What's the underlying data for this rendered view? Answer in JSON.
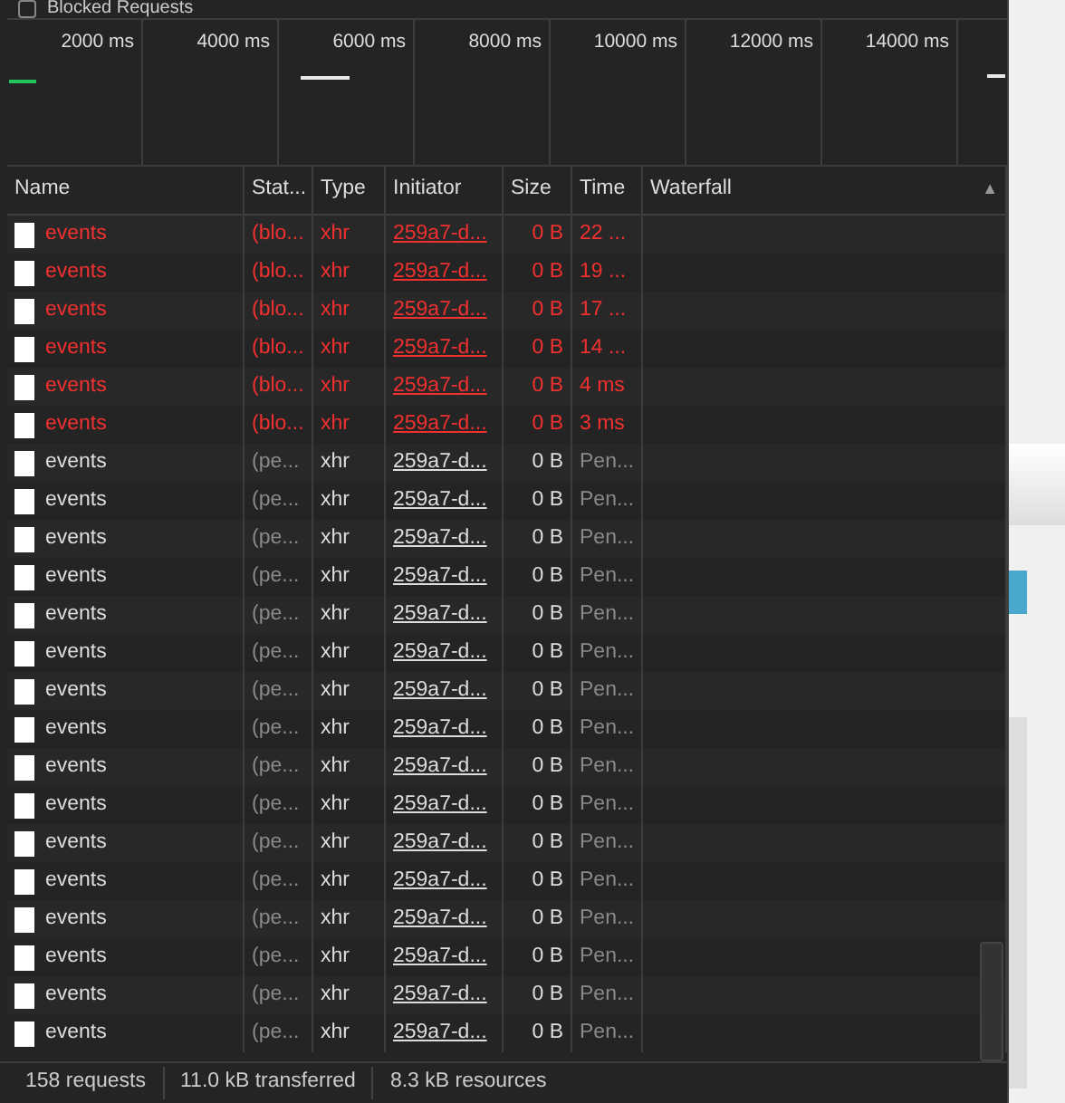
{
  "filter_bar": {
    "blocked_requests": {
      "label": "Blocked Requests",
      "checked": false
    }
  },
  "overview": {
    "ticks": [
      "2000 ms",
      "4000 ms",
      "6000 ms",
      "8000 ms",
      "10000 ms",
      "12000 ms",
      "14000 ms"
    ]
  },
  "table": {
    "columns": [
      {
        "label": "Name"
      },
      {
        "label": "Stat..."
      },
      {
        "label": "Type"
      },
      {
        "label": "Initiator"
      },
      {
        "label": "Size"
      },
      {
        "label": "Time"
      },
      {
        "label": "Waterfall",
        "sort_icon": "▲"
      }
    ],
    "rows": [
      {
        "kind": "blocked",
        "name": "events",
        "status": "(blo...",
        "type": "xhr",
        "initiator": "259a7-d...",
        "size": "0 B",
        "time": "22 ..."
      },
      {
        "kind": "blocked",
        "name": "events",
        "status": "(blo...",
        "type": "xhr",
        "initiator": "259a7-d...",
        "size": "0 B",
        "time": "19 ..."
      },
      {
        "kind": "blocked",
        "name": "events",
        "status": "(blo...",
        "type": "xhr",
        "initiator": "259a7-d...",
        "size": "0 B",
        "time": "17 ..."
      },
      {
        "kind": "blocked",
        "name": "events",
        "status": "(blo...",
        "type": "xhr",
        "initiator": "259a7-d...",
        "size": "0 B",
        "time": "14 ..."
      },
      {
        "kind": "blocked",
        "name": "events",
        "status": "(blo...",
        "type": "xhr",
        "initiator": "259a7-d...",
        "size": "0 B",
        "time": "4 ms"
      },
      {
        "kind": "blocked",
        "name": "events",
        "status": "(blo...",
        "type": "xhr",
        "initiator": "259a7-d...",
        "size": "0 B",
        "time": "3 ms"
      },
      {
        "kind": "pending",
        "name": "events",
        "status": "(pe...",
        "type": "xhr",
        "initiator": "259a7-d...",
        "size": "0 B",
        "time": "Pen..."
      },
      {
        "kind": "pending",
        "name": "events",
        "status": "(pe...",
        "type": "xhr",
        "initiator": "259a7-d...",
        "size": "0 B",
        "time": "Pen..."
      },
      {
        "kind": "pending",
        "name": "events",
        "status": "(pe...",
        "type": "xhr",
        "initiator": "259a7-d...",
        "size": "0 B",
        "time": "Pen..."
      },
      {
        "kind": "pending",
        "name": "events",
        "status": "(pe...",
        "type": "xhr",
        "initiator": "259a7-d...",
        "size": "0 B",
        "time": "Pen..."
      },
      {
        "kind": "pending",
        "name": "events",
        "status": "(pe...",
        "type": "xhr",
        "initiator": "259a7-d...",
        "size": "0 B",
        "time": "Pen..."
      },
      {
        "kind": "pending",
        "name": "events",
        "status": "(pe...",
        "type": "xhr",
        "initiator": "259a7-d...",
        "size": "0 B",
        "time": "Pen..."
      },
      {
        "kind": "pending",
        "name": "events",
        "status": "(pe...",
        "type": "xhr",
        "initiator": "259a7-d...",
        "size": "0 B",
        "time": "Pen..."
      },
      {
        "kind": "pending",
        "name": "events",
        "status": "(pe...",
        "type": "xhr",
        "initiator": "259a7-d...",
        "size": "0 B",
        "time": "Pen..."
      },
      {
        "kind": "pending",
        "name": "events",
        "status": "(pe...",
        "type": "xhr",
        "initiator": "259a7-d...",
        "size": "0 B",
        "time": "Pen..."
      },
      {
        "kind": "pending",
        "name": "events",
        "status": "(pe...",
        "type": "xhr",
        "initiator": "259a7-d...",
        "size": "0 B",
        "time": "Pen..."
      },
      {
        "kind": "pending",
        "name": "events",
        "status": "(pe...",
        "type": "xhr",
        "initiator": "259a7-d...",
        "size": "0 B",
        "time": "Pen..."
      },
      {
        "kind": "pending",
        "name": "events",
        "status": "(pe...",
        "type": "xhr",
        "initiator": "259a7-d...",
        "size": "0 B",
        "time": "Pen..."
      },
      {
        "kind": "pending",
        "name": "events",
        "status": "(pe...",
        "type": "xhr",
        "initiator": "259a7-d...",
        "size": "0 B",
        "time": "Pen..."
      },
      {
        "kind": "pending",
        "name": "events",
        "status": "(pe...",
        "type": "xhr",
        "initiator": "259a7-d...",
        "size": "0 B",
        "time": "Pen..."
      },
      {
        "kind": "pending",
        "name": "events",
        "status": "(pe...",
        "type": "xhr",
        "initiator": "259a7-d...",
        "size": "0 B",
        "time": "Pen..."
      },
      {
        "kind": "pending",
        "name": "events",
        "status": "(pe...",
        "type": "xhr",
        "initiator": "259a7-d...",
        "size": "0 B",
        "time": "Pen..."
      }
    ]
  },
  "status_bar": [
    "158 requests",
    "11.0 kB transferred",
    "8.3 kB resources"
  ]
}
